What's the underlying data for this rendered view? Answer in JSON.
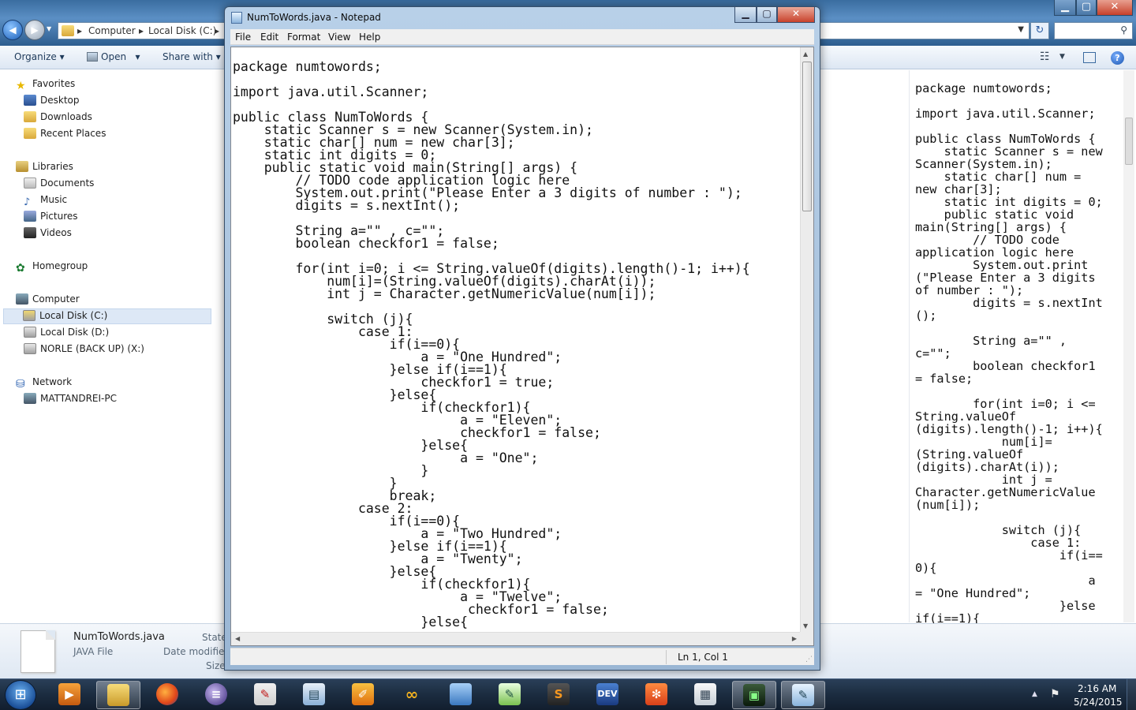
{
  "explorer": {
    "address": {
      "computer": "Computer",
      "disk": "Local Disk (C:)",
      "separator": "▸"
    },
    "toolbar": {
      "organize": "Organize ▾",
      "open": "Open",
      "open_dd": "▾",
      "share": "Share with ▾"
    },
    "nav": {
      "favorites": "Favorites",
      "desktop": "Desktop",
      "downloads": "Downloads",
      "recent": "Recent Places",
      "libraries": "Libraries",
      "documents": "Documents",
      "music": "Music",
      "pictures": "Pictures",
      "videos": "Videos",
      "homegroup": "Homegroup",
      "computer": "Computer",
      "disk_c": "Local Disk (C:)",
      "disk_d": "Local Disk (D:)",
      "disk_x": "NORLE (BACK UP) (X:)",
      "network": "Network",
      "pc": "MATTANDREI-PC"
    },
    "details": {
      "file_name": "NumToWords.java",
      "file_type": "JAVA File",
      "state_label": "State",
      "modified_label": "Date modified",
      "size_label": "Size"
    },
    "preview_code": "package numtowords;\n\nimport java.util.Scanner;\n\npublic class NumToWords {\n    static Scanner s = new\nScanner(System.in);\n    static char[] num =\nnew char[3];\n    static int digits = 0;\n    public static void\nmain(String[] args) {\n        // TODO code\napplication logic here\n        System.out.print\n(\"Please Enter a 3 digits\nof number : \");\n        digits = s.nextInt\n();\n\n        String a=\"\" ,\nc=\"\";\n        boolean checkfor1\n= false;\n\n        for(int i=0; i <=\nString.valueOf\n(digits).length()-1; i++){\n            num[i]=\n(String.valueOf\n(digits).charAt(i));\n            int j =\nCharacter.getNumericValue\n(num[i]);\n\n            switch (j){\n                case 1:\n                    if(i==\n0){\n                        a\n= \"One Hundred\";\n                    }else\nif(i==1){"
  },
  "notepad": {
    "title": "NumToWords.java - Notepad",
    "menu": {
      "file": "File",
      "edit": "Edit",
      "format": "Format",
      "view": "View",
      "help": "Help"
    },
    "code": "package numtowords;\n\nimport java.util.Scanner;\n\npublic class NumToWords {\n    static Scanner s = new Scanner(System.in);\n    static char[] num = new char[3];\n    static int digits = 0;\n    public static void main(String[] args) {\n        // TODO code application logic here\n        System.out.print(\"Please Enter a 3 digits of number : \");\n        digits = s.nextInt();\n\n        String a=\"\" , c=\"\";\n        boolean checkfor1 = false;\n\n        for(int i=0; i <= String.valueOf(digits).length()-1; i++){\n            num[i]=(String.valueOf(digits).charAt(i));\n            int j = Character.getNumericValue(num[i]);\n\n            switch (j){\n                case 1:\n                    if(i==0){\n                        a = \"One Hundred\";\n                    }else if(i==1){\n                        checkfor1 = true;\n                    }else{\n                        if(checkfor1){\n                             a = \"Eleven\";\n                             checkfor1 = false;\n                        }else{\n                             a = \"One\";\n                        }\n                    }\n                    break;\n                case 2:\n                    if(i==0){\n                        a = \"Two Hundred\";\n                    }else if(i==1){\n                        a = \"Twenty\";\n                    }else{\n                        if(checkfor1){\n                             a = \"Twelve\";\n                              checkfor1 = false;\n                        }else{",
    "status": "Ln 1, Col 1"
  },
  "taskbar": {
    "clock_time": "2:16 AM",
    "clock_date": "5/24/2015",
    "icons": [
      "media-player-icon",
      "file-explorer-icon",
      "firefox-icon",
      "eclipse-icon",
      "pdf-reader-icon",
      "document-icon",
      "paint-icon",
      "arduino-icon",
      "virtualbox-icon",
      "notepad-plus-icon",
      "sublime-text-icon",
      "dev-cpp-icon",
      "xampp-icon",
      "app-window-icon",
      "cmd-icon",
      "notepad-icon"
    ],
    "dev_label": "DEV"
  }
}
